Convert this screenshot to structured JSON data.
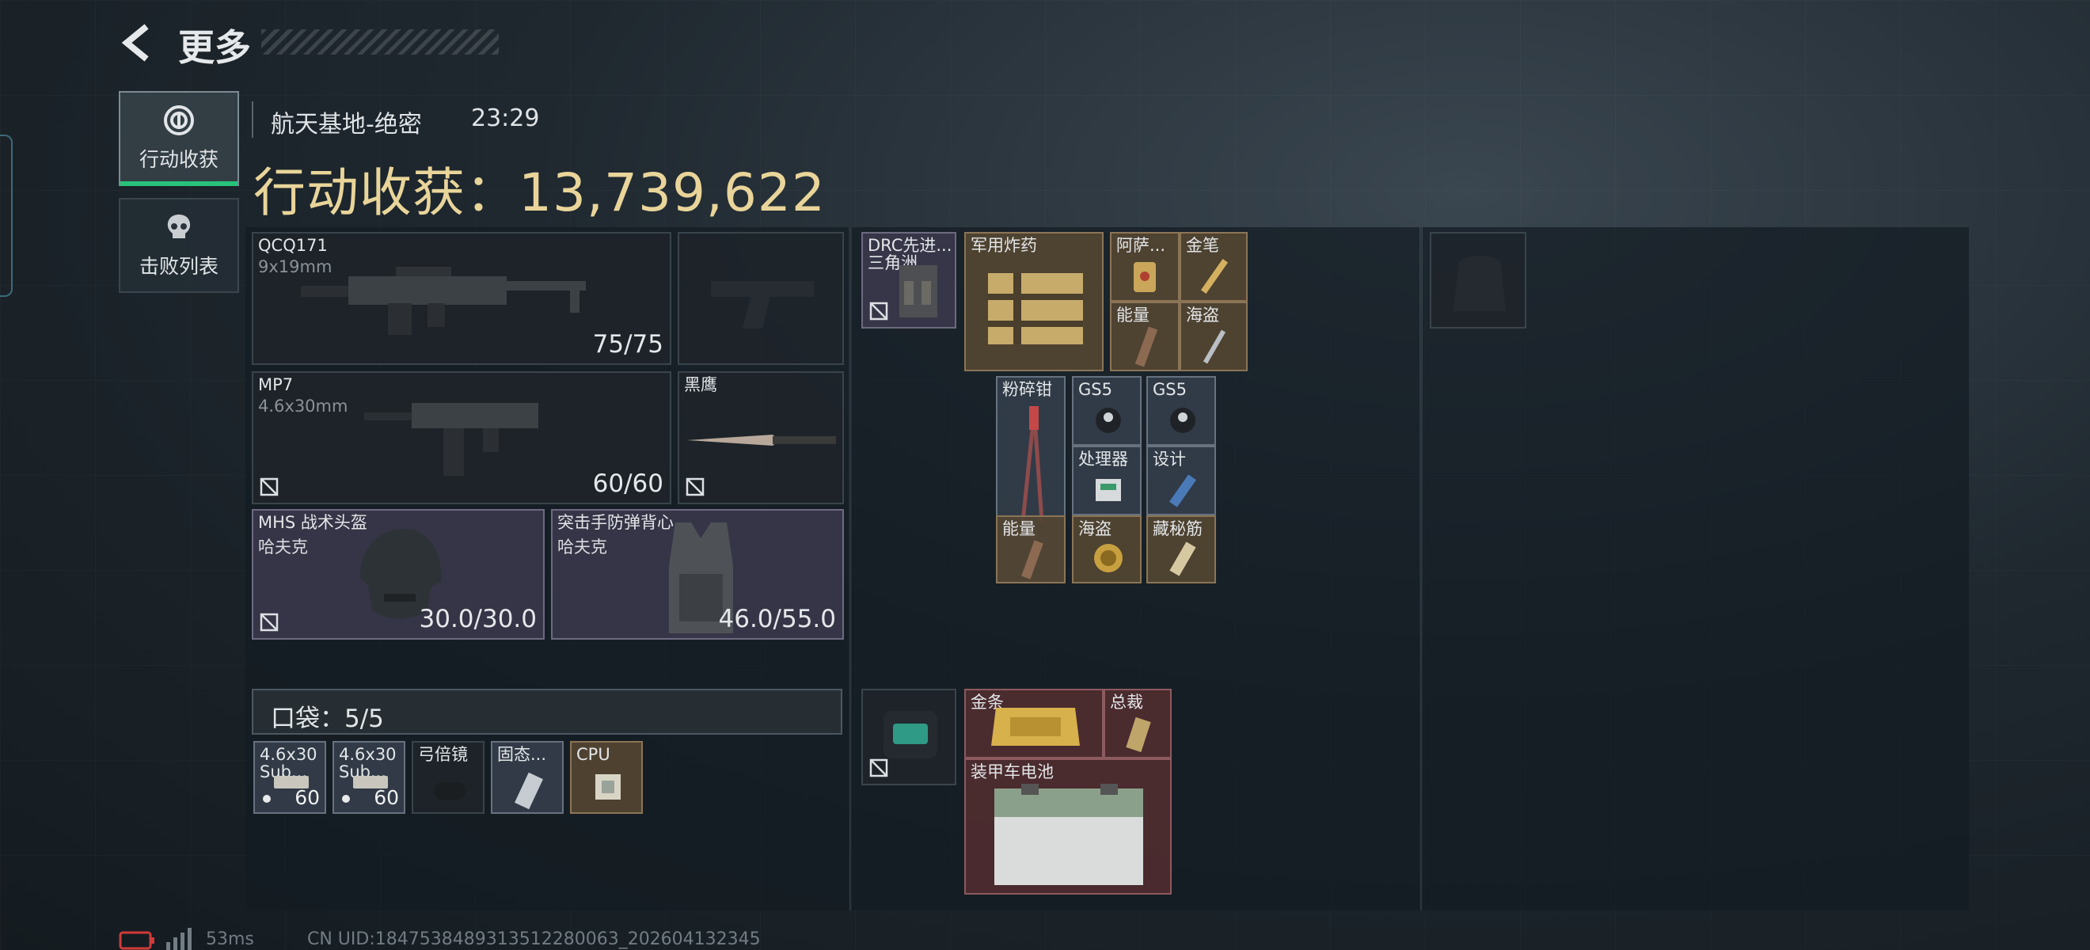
{
  "header": {
    "title": "更多"
  },
  "tabs": [
    {
      "label": "行动收获",
      "icon": "target-icon",
      "active": true
    },
    {
      "label": "击败列表",
      "icon": "skull-icon",
      "active": false
    }
  ],
  "raid": {
    "map": "航天基地-绝密",
    "time": "23:29",
    "harvest": "行动收获：13,739,622"
  },
  "weapons": [
    {
      "name": "QCQ171",
      "caliber": "9x19mm",
      "durability": "75/75"
    },
    {
      "name": "MP7",
      "caliber": "4.6x30mm",
      "durability": "60/60"
    }
  ],
  "knife": {
    "name": "黑鹰"
  },
  "armor": [
    {
      "name": "MHS 战术头盔",
      "brand": "哈夫克",
      "durability": "30.0/30.0"
    },
    {
      "name": "突击手防弹背心",
      "brand": "哈夫克",
      "durability": "46.0/55.0"
    }
  ],
  "pocket": {
    "label": "口袋：5/5",
    "items": [
      {
        "name": "4.6x30\nSub...",
        "count": "60"
      },
      {
        "name": "4.6x30\nSub...",
        "count": "60"
      },
      {
        "name": "弓倍镜"
      },
      {
        "name": "固态..."
      },
      {
        "name": "CPU"
      }
    ]
  },
  "rig": {
    "name": "DRC先进...\n三角洲",
    "items": [
      {
        "name": "军用炸药"
      },
      {
        "name": "阿萨..."
      },
      {
        "name": "金笔"
      },
      {
        "name": "能量"
      },
      {
        "name": "海盗"
      },
      {
        "name": "粉碎钳"
      },
      {
        "name": "GS5"
      },
      {
        "name": "GS5"
      },
      {
        "name": "处理器"
      },
      {
        "name": "设计"
      },
      {
        "name": "能量"
      },
      {
        "name": "海盗"
      },
      {
        "name": "藏秘筋"
      }
    ]
  },
  "backpack": {
    "items": [
      {
        "name": "金条"
      },
      {
        "name": "总裁"
      },
      {
        "name": "装甲车电池"
      }
    ]
  },
  "footer": {
    "ping": "53ms",
    "uid": "CN UID:1847538489313512280063_202604132345"
  },
  "colors": {
    "accent": "#27c27a",
    "harvest": "#e9d59a",
    "gold_slot": "#8b7556",
    "red_slot": "#8c5a5f"
  }
}
